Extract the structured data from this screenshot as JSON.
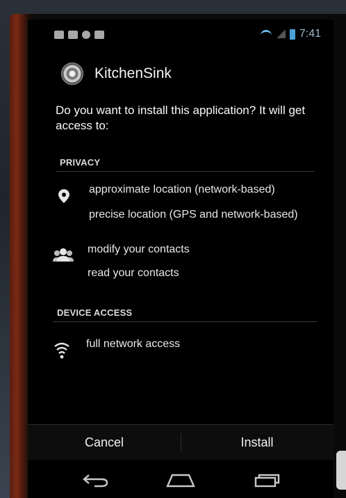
{
  "status_bar": {
    "time": "7:41",
    "left_icons": [
      "notification-icon",
      "mail-icon",
      "sync-icon",
      "mail-icon"
    ]
  },
  "app": {
    "name": "KitchenSink",
    "icon": "app-icon"
  },
  "question": "Do you want to install this application? It will get access to:",
  "sections": [
    {
      "title": "PRIVACY",
      "groups": [
        {
          "icon": "location-pin-icon",
          "items": [
            "approximate location (network-based)",
            "precise location (GPS and network-based)"
          ]
        },
        {
          "icon": "contacts-icon",
          "items": [
            "modify your contacts",
            "read your contacts"
          ]
        }
      ]
    },
    {
      "title": "DEVICE ACCESS",
      "groups": [
        {
          "icon": "wifi-icon",
          "items": [
            "full network access"
          ]
        }
      ]
    }
  ],
  "buttons": {
    "cancel": "Cancel",
    "install": "Install"
  },
  "nav": {
    "back": "back-icon",
    "home": "home-icon",
    "recent": "recent-apps-icon"
  },
  "colors": {
    "screen_bg": "#000000",
    "accent_status": "#4aa3d8",
    "text": "#f2f2f2"
  }
}
